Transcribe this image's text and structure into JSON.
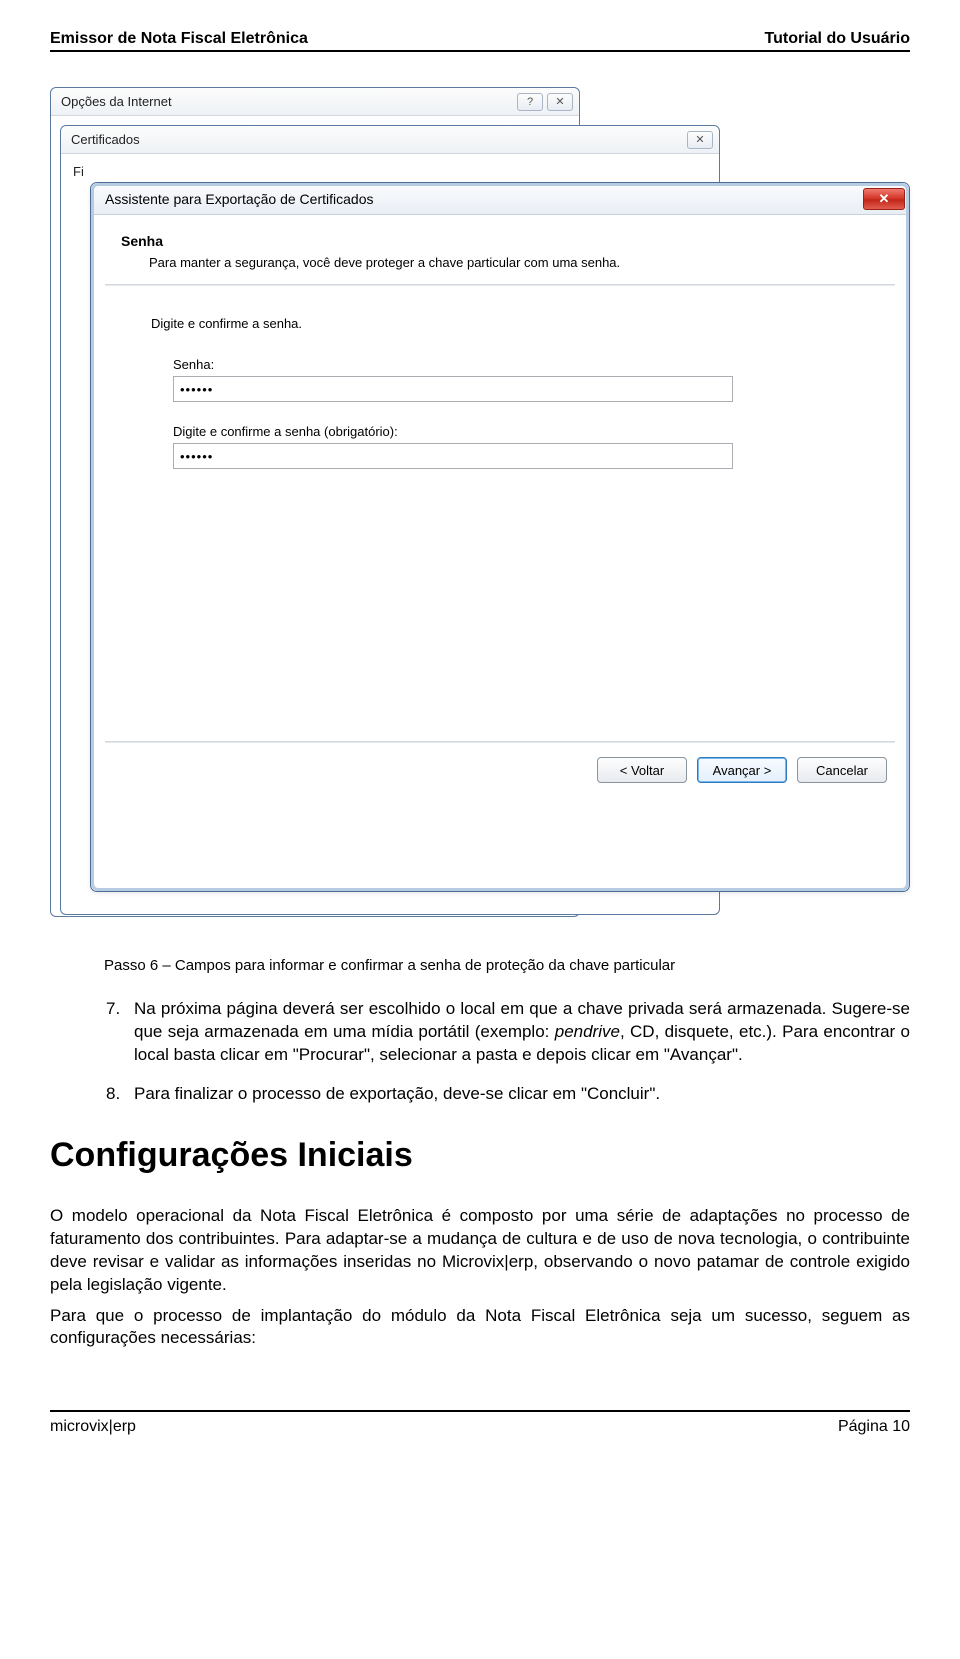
{
  "header": {
    "left": "Emissor de Nota Fiscal Eletrônica",
    "right": "Tutorial do Usuário"
  },
  "footer": {
    "left": "microvix|erp",
    "right": "Página 10"
  },
  "back_window": {
    "title": "Opções da Internet",
    "help_glyph": "?",
    "close_glyph": "✕"
  },
  "mid_window": {
    "title": "Certificados",
    "close_glyph": "✕",
    "peek_label": "Fi"
  },
  "wizard": {
    "title": "Assistente para Exportação de Certificados",
    "close_glyph": "✕",
    "head_title": "Senha",
    "head_sub": "Para manter a segurança, você deve proteger a chave particular com uma senha.",
    "instruction": "Digite e confirme a senha.",
    "pw_label": "Senha:",
    "pw_value": "••••••",
    "pw2_label": "Digite e confirme a senha (obrigatório):",
    "pw2_value": "••••••",
    "btn_back": "<  Voltar",
    "btn_next": "Avançar  >",
    "btn_cancel": "Cancelar"
  },
  "caption": "Passo 6 – Campos para informar e confirmar a senha de proteção da chave particular",
  "steps": {
    "n7": "7.",
    "t7a": "Na próxima página deverá ser escolhido o local em que a chave privada será armazenada. Sugere-se que seja armazenada em uma mídia portátil (exemplo: ",
    "t7_italic": "pendrive",
    "t7b": ", CD, disquete, etc.). Para encontrar o local basta clicar em \"Procurar\", selecionar a pasta e depois clicar em \"Avançar\".",
    "n8": "8.",
    "t8": "Para finalizar o processo de exportação, deve-se clicar em \"Concluir\"."
  },
  "section_title": "Configurações Iniciais",
  "para1": "O modelo operacional da Nota Fiscal Eletrônica é composto por uma série de adaptações no processo de faturamento dos contribuintes. Para adaptar-se a mudança de cultura e de uso de nova tecnologia, o contribuinte deve revisar e validar as informações inseridas no Microvix|erp, observando o novo patamar de controle exigido pela legislação vigente.",
  "para2": "Para que o processo de implantação do módulo da Nota Fiscal Eletrônica seja um sucesso, seguem as configurações necessárias:"
}
